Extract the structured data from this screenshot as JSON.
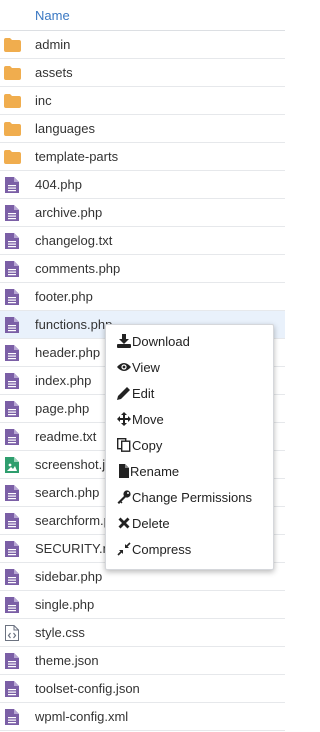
{
  "table": {
    "column_name": "Name"
  },
  "files": [
    {
      "name": "admin",
      "type": "folder"
    },
    {
      "name": "assets",
      "type": "folder"
    },
    {
      "name": "inc",
      "type": "folder"
    },
    {
      "name": "languages",
      "type": "folder"
    },
    {
      "name": "template-parts",
      "type": "folder"
    },
    {
      "name": "404.php",
      "type": "file"
    },
    {
      "name": "archive.php",
      "type": "file"
    },
    {
      "name": "changelog.txt",
      "type": "file"
    },
    {
      "name": "comments.php",
      "type": "file"
    },
    {
      "name": "footer.php",
      "type": "file"
    },
    {
      "name": "functions.php",
      "type": "file",
      "selected": true
    },
    {
      "name": "header.php",
      "type": "file"
    },
    {
      "name": "index.php",
      "type": "file"
    },
    {
      "name": "page.php",
      "type": "file"
    },
    {
      "name": "readme.txt",
      "type": "file"
    },
    {
      "name": "screenshot.j",
      "type": "image"
    },
    {
      "name": "search.php",
      "type": "file"
    },
    {
      "name": "searchform.p",
      "type": "file"
    },
    {
      "name": "SECURITY.m",
      "type": "file"
    },
    {
      "name": "sidebar.php",
      "type": "file"
    },
    {
      "name": "single.php",
      "type": "file"
    },
    {
      "name": "style.css",
      "type": "code"
    },
    {
      "name": "theme.json",
      "type": "file"
    },
    {
      "name": "toolset-config.json",
      "type": "file"
    },
    {
      "name": "wpml-config.xml",
      "type": "file"
    }
  ],
  "context_menu": {
    "items": [
      {
        "label": "Download",
        "icon": "download-icon"
      },
      {
        "label": "View",
        "icon": "eye-icon"
      },
      {
        "label": "Edit",
        "icon": "pencil-icon"
      },
      {
        "label": "Move",
        "icon": "move-arrows-icon"
      },
      {
        "label": "Copy",
        "icon": "copy-icon"
      },
      {
        "label": "Rename",
        "icon": "file-icon"
      },
      {
        "label": "Change Permissions",
        "icon": "key-icon"
      },
      {
        "label": "Delete",
        "icon": "x-icon"
      },
      {
        "label": "Compress",
        "icon": "compress-icon"
      }
    ]
  },
  "colors": {
    "header_text": "#3a78c3",
    "folder": "#f0ad4e",
    "file": "#7b5fa6",
    "image_file": "#2e9e6e",
    "code_file": "#6b7280",
    "selected_row": "#e9f1fb"
  }
}
